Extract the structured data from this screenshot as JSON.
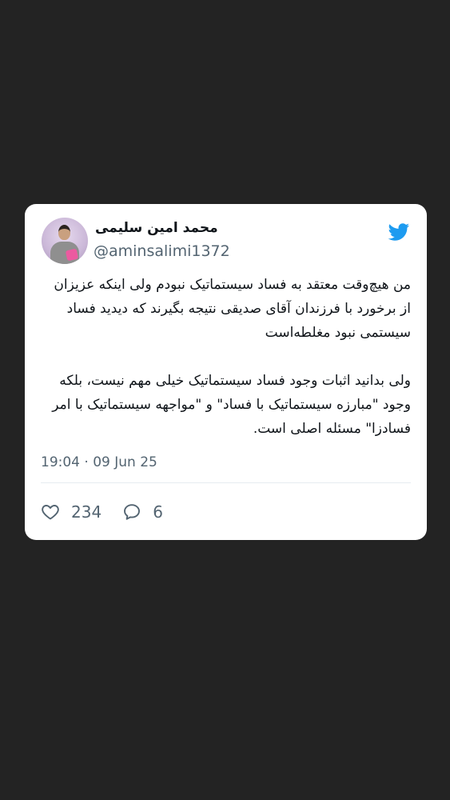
{
  "tweet": {
    "author_name": "محمد امین سلیمی",
    "author_handle": "@aminsalimi1372",
    "paragraph_1": "من هیچ‌وقت معتقد به فساد سیستماتیک نبودم ولی اینکه عزیزان از برخورد با فرزندان آقای صدیقی نتیجه بگیرند که دیدید فساد سیستمی نبود مغلطه‌است",
    "paragraph_2": "ولی بدانید اثبات وجود فساد سیستماتیک خیلی مهم نیست، بلکه وجود \"مبارزه سیستماتیک با فساد\" و \"مواجهه سیستماتیک با امر فسادزا\" مسئله اصلی است.",
    "timestamp": "19:04 · 09 Jun 25",
    "likes": "234",
    "replies": "6"
  },
  "colors": {
    "background": "#232323",
    "card": "#ffffff",
    "text": "#0f1419",
    "muted": "#536471",
    "twitter_blue": "#1d9bf0"
  },
  "icons": {
    "brand": "twitter-bird-icon",
    "like": "heart-icon",
    "reply": "comment-icon"
  }
}
